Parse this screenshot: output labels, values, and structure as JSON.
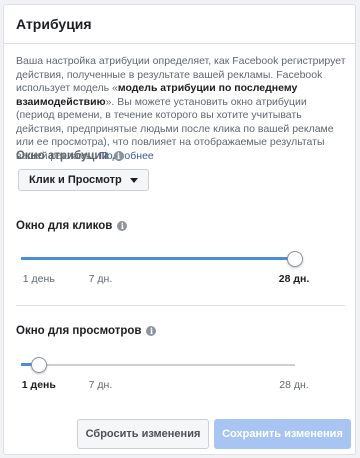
{
  "panel": {
    "title": "Атрибуция",
    "description": {
      "part1": "Ваша настройка атрибуции определяет, как Facebook регистрирует действия, полученные в результате вашей рекламы. Facebook использует модель «",
      "bold": "модель атрибуции по последнему взаимодействию",
      "part2": "». Вы можете установить окно атрибуции (период времени, в течение которого вы хотите учитывать действия, предпринятые людьми после клика по вашей рекламе или ее просмотра), что повлияет на отображаемые результаты вашей рекламы.",
      "link": "Подробнее"
    }
  },
  "attribution_window": {
    "label": "Окно атрибуции",
    "selected": "Клик и Просмотр"
  },
  "click_window": {
    "label": "Окно для кликов",
    "ticks": [
      "1 день",
      "7 дн.",
      "28 дн."
    ],
    "selected_index": 2
  },
  "view_window": {
    "label": "Окно для просмотров",
    "ticks": [
      "1 день",
      "7 дн.",
      "28 дн."
    ],
    "selected_index": 0
  },
  "buttons": {
    "reset": "Сбросить изменения",
    "save": "Сохранить изменения"
  },
  "icons": {
    "info": "info-icon",
    "dropdown": "caret-down-icon"
  },
  "colors": {
    "accent": "#4a90d9",
    "save_disabled": "#a7c4f2",
    "link": "#385898"
  }
}
